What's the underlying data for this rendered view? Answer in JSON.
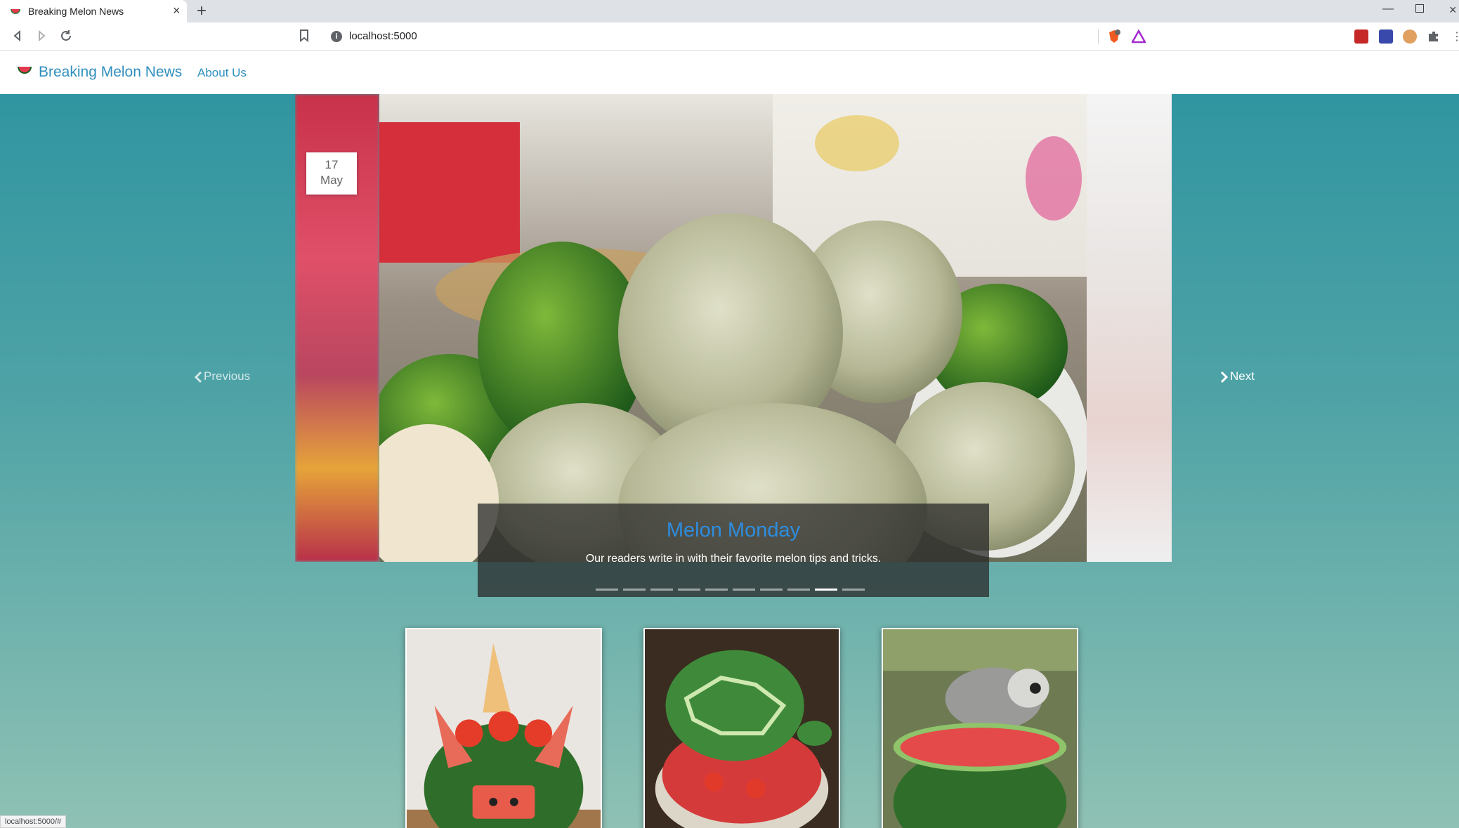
{
  "browser": {
    "tab_title": "Breaking Melon News",
    "tab_close": "×",
    "new_tab": "+",
    "url": "localhost:5000",
    "status_url": "localhost:5000/#"
  },
  "navbar": {
    "brand": "Breaking Melon News",
    "about": "About Us"
  },
  "carousel": {
    "date_day": "17",
    "date_month": "May",
    "caption_title": "Melon Monday",
    "caption_text": "Our readers write in with their favorite melon tips and tricks.",
    "indicator_count": 10,
    "active_indicator": 9,
    "prev_label": "Previous",
    "next_label": "Next"
  },
  "colors": {
    "brand": "#2f8fbd",
    "caption_title": "#2d8de0",
    "page_top": "#2c93a0",
    "page_bottom": "#8fc1b4"
  },
  "thumbnails": [
    {
      "subject": "watermelon carved as a unicorn"
    },
    {
      "subject": "watermelon carved as a turtle"
    },
    {
      "subject": "lemur eating a watermelon"
    }
  ]
}
